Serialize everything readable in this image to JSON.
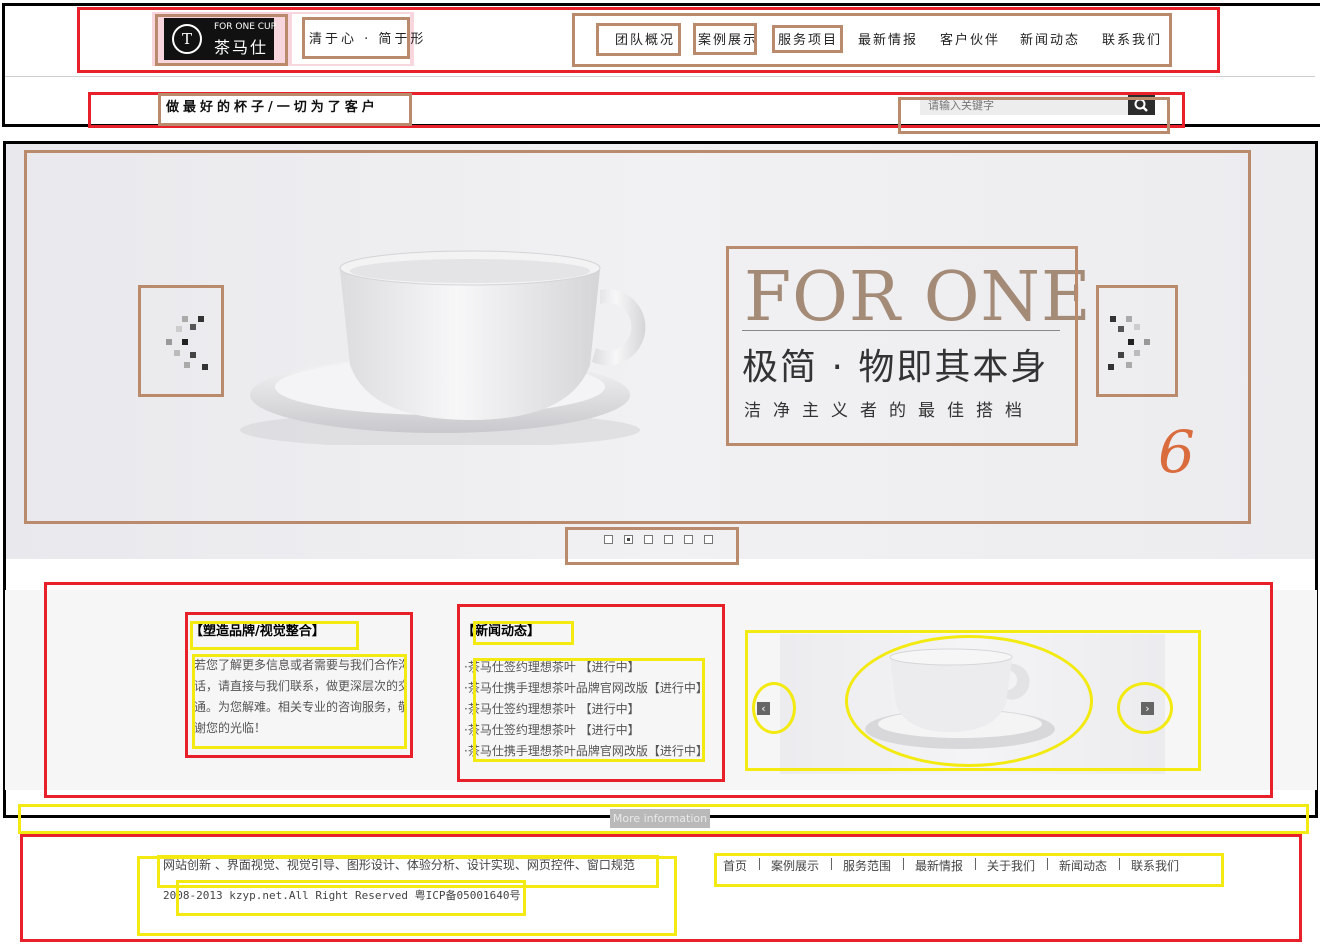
{
  "header": {
    "logo": {
      "mark": "T",
      "english": "FOR ONE CUP",
      "chinese": "茶马仕"
    },
    "slogan": "清于心 · 简于形",
    "nav": [
      "团队概况",
      "案例展示",
      "服务项目",
      "最新情报",
      "客户伙伴",
      "新闻动态",
      "联系我们"
    ],
    "tagline": "做最好的杯子/一切为了客户",
    "search": {
      "placeholder": "请输入关键字"
    }
  },
  "banner": {
    "title_en": "FOR ONE",
    "title_cn": "极简 · 物即其本身",
    "subtitle": "洁净主义者的最佳搭档",
    "slide_count": 6,
    "active_slide": 2,
    "annotation": "6"
  },
  "info": {
    "brand": {
      "title": "【塑造品牌/视觉整合】",
      "text": [
        "若您了解更多信息或者需要与我们合作沟",
        "话，请直接与我们联系，做更深层次的交",
        "通。为您解难。相关专业的咨询服务，敬",
        "谢您的光临！"
      ]
    },
    "news": {
      "title": "【新闻动态】",
      "items": [
        "·茶马仕签约理想茶叶 【进行中】",
        "·茶马仕携手理想茶叶品牌官网改版【进行中】",
        "·茶马仕签约理想茶叶 【进行中】",
        "·茶马仕签约理想茶叶 【进行中】",
        "·茶马仕携手理想茶叶品牌官网改版【进行中】"
      ]
    },
    "gallery": {
      "prev_glyph": "‹",
      "next_glyph": "›"
    }
  },
  "more": {
    "label": "More information"
  },
  "footer": {
    "services": "网站创新 、界面视觉、视觉引导、图形设计、体验分析、设计实现、网页控件、窗口规范",
    "copyright": "2008-2013 kzyp.net.All Right Reserved 粤ICP备05001640号",
    "links": [
      "首页",
      "案例展示",
      "服务范围",
      "最新情报",
      "关于我们",
      "新闻动态",
      "联系我们"
    ]
  },
  "colors": {
    "accent_brown": "#a48b78",
    "annotation_red": "#e8202a",
    "annotation_yellow": "#f2ea10",
    "annotation_brown": "#b98a6c"
  }
}
